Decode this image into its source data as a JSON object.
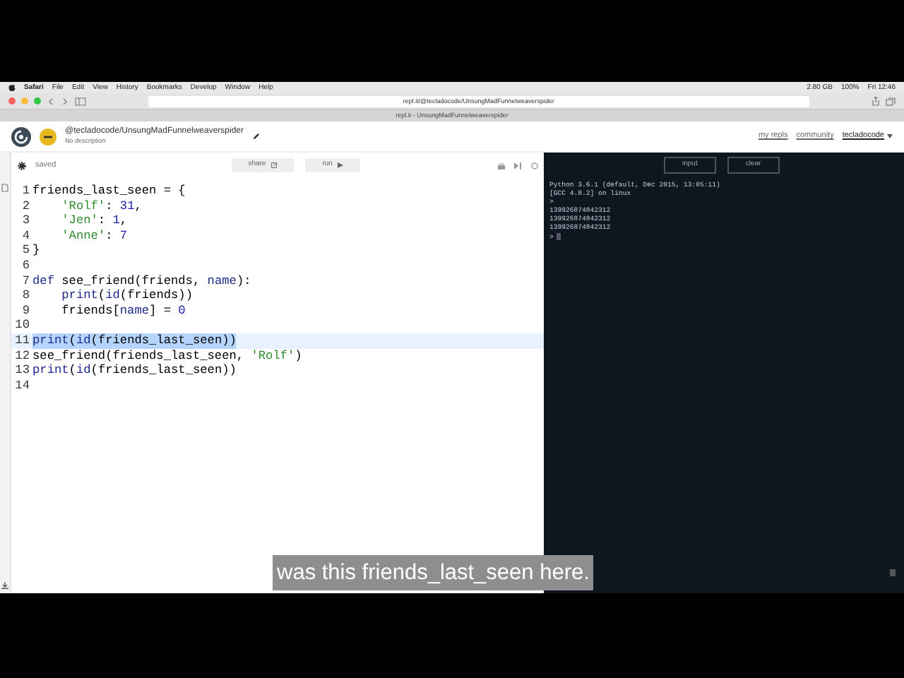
{
  "menu_bar": {
    "app": "Safari",
    "items": [
      "File",
      "Edit",
      "View",
      "History",
      "Bookmarks",
      "Develop",
      "Window",
      "Help"
    ],
    "status": [
      "2.80 GB",
      "100%",
      "Fri 12:46"
    ]
  },
  "browser": {
    "url": "repl.it/@tecladocode/UnsungMadFunnelweaverspider",
    "tab_title": "repl.it - UnsungMadFunnelweaverspider"
  },
  "repl_header": {
    "path": "@tecladocode/UnsungMadFunnelweaverspider",
    "description": "No description",
    "nav": [
      "my repls",
      "community"
    ],
    "user": "tecladocode"
  },
  "editor": {
    "status": "saved",
    "buttons": [
      "share",
      "run"
    ],
    "lines": [
      {
        "number": "1",
        "selected": false,
        "tokens": [
          {
            "kind": "plain",
            "text": "friends_last_seen = {"
          }
        ]
      },
      {
        "number": "2",
        "selected": false,
        "indented": true,
        "tokens": [
          {
            "kind": "string",
            "text": "'Rolf'"
          },
          {
            "kind": "plain",
            "text": ": "
          },
          {
            "kind": "number",
            "text": "31"
          },
          {
            "kind": "plain",
            "text": ","
          }
        ]
      },
      {
        "number": "3",
        "selected": false,
        "indented": true,
        "tokens": [
          {
            "kind": "string",
            "text": "'Jen'"
          },
          {
            "kind": "plain",
            "text": ": "
          },
          {
            "kind": "number",
            "text": "1"
          },
          {
            "kind": "plain",
            "text": ","
          }
        ]
      },
      {
        "number": "4",
        "selected": false,
        "indented": true,
        "tokens": [
          {
            "kind": "string",
            "text": "'Anne'"
          },
          {
            "kind": "plain",
            "text": ": "
          },
          {
            "kind": "number",
            "text": "7"
          }
        ]
      },
      {
        "number": "5",
        "selected": false,
        "tokens": [
          {
            "kind": "plain",
            "text": "}"
          }
        ]
      },
      {
        "number": "6",
        "selected": false
      },
      {
        "number": "7",
        "selected": false,
        "tokens": [
          {
            "kind": "keyword",
            "text": "def"
          },
          {
            "kind": "plain",
            "text": " see_friend(friends, "
          },
          {
            "kind": "keyword",
            "text": "name"
          },
          {
            "kind": "plain",
            "text": "):"
          }
        ]
      },
      {
        "number": "8",
        "selected": false,
        "indented": true,
        "tokens": [
          {
            "kind": "keyword",
            "text": "print"
          },
          {
            "kind": "plain",
            "text": "("
          },
          {
            "kind": "keyword",
            "text": "id"
          },
          {
            "kind": "plain",
            "text": "(friends))"
          }
        ]
      },
      {
        "number": "9",
        "selected": false,
        "indented": true,
        "tokens": [
          {
            "kind": "plain",
            "text": "friends["
          },
          {
            "kind": "keyword",
            "text": "name"
          },
          {
            "kind": "plain",
            "text": "] = "
          },
          {
            "kind": "number",
            "text": "0"
          }
        ]
      },
      {
        "number": "10",
        "selected": false
      },
      {
        "number": "11",
        "selected": true,
        "tokens": [
          {
            "kind": "keyword",
            "text": "print"
          },
          {
            "kind": "plain",
            "text": "("
          },
          {
            "kind": "keyword",
            "text": "id"
          },
          {
            "kind": "plain",
            "text": "(friends_last_seen))"
          }
        ]
      },
      {
        "number": "12",
        "selected": false,
        "tokens": [
          {
            "kind": "plain",
            "text": "see_friend(friends_last_seen, "
          },
          {
            "kind": "string",
            "text": "'Rolf'"
          },
          {
            "kind": "plain",
            "text": ")"
          }
        ]
      },
      {
        "number": "13",
        "selected": false,
        "tokens": [
          {
            "kind": "keyword",
            "text": "print"
          },
          {
            "kind": "plain",
            "text": "("
          },
          {
            "kind": "keyword",
            "text": "id"
          },
          {
            "kind": "plain",
            "text": "(friends_last_seen))"
          }
        ]
      },
      {
        "number": "14",
        "selected": false
      }
    ]
  },
  "console": {
    "buttons": [
      "input",
      "clear"
    ],
    "lines": [
      "Python 3.6.1 (default, Dec 2015, 13:05:11)",
      "[GCC 4.8.2] on linux",
      ">",
      "139926874842312",
      "139926874842312",
      "139926874842312",
      ">"
    ]
  },
  "caption": "was this friends_last_seen here."
}
